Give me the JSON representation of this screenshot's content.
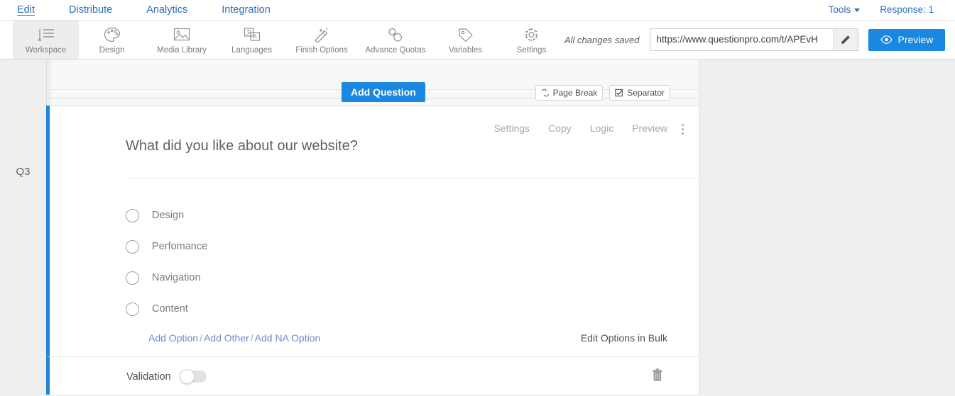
{
  "topnav": {
    "items": [
      {
        "label": "Edit",
        "active": true
      },
      {
        "label": "Distribute",
        "active": false
      },
      {
        "label": "Analytics",
        "active": false
      },
      {
        "label": "Integration",
        "active": false
      }
    ],
    "tools_label": "Tools",
    "response_label": "Response: 1"
  },
  "toolbar": {
    "items": [
      {
        "label": "Workspace",
        "icon": "workspace-icon",
        "active": true
      },
      {
        "label": "Design",
        "icon": "palette-icon",
        "active": false
      },
      {
        "label": "Media Library",
        "icon": "image-icon",
        "active": false
      },
      {
        "label": "Languages",
        "icon": "translate-icon",
        "active": false
      },
      {
        "label": "Finish Options",
        "icon": "magic-wand-icon",
        "active": false
      },
      {
        "label": "Advance Quotas",
        "icon": "link-chain-icon",
        "active": false
      },
      {
        "label": "Variables",
        "icon": "tag-icon",
        "active": false
      },
      {
        "label": "Settings",
        "icon": "gear-icon",
        "active": false
      }
    ],
    "saved_status": "All changes saved",
    "survey_url": "https://www.questionpro.com/t/APEvH",
    "edit_icon": "pencil-icon",
    "preview_label": "Preview",
    "preview_icon": "eye-icon"
  },
  "addbar": {
    "add_question_label": "Add Question",
    "page_break_label": "Page Break",
    "page_break_icon": "page-break-icon",
    "separator_label": "Separator",
    "separator_icon": "checked-box-icon"
  },
  "question": {
    "number": "Q3",
    "title": "What did you like about our website?",
    "actions": [
      "Settings",
      "Copy",
      "Logic",
      "Preview"
    ],
    "kebab_icon": "more-vertical-icon",
    "options": [
      {
        "label": "Design",
        "selected": false
      },
      {
        "label": "Perfomance",
        "selected": false
      },
      {
        "label": "Navigation",
        "selected": false
      },
      {
        "label": "Content",
        "selected": false
      }
    ],
    "add_links": [
      "Add Option",
      "Add Other",
      "Add NA Option"
    ],
    "link_separator": "/",
    "bulk_edit_label": "Edit Options in Bulk",
    "validation_label": "Validation",
    "validation_on": false,
    "delete_icon": "trash-icon"
  },
  "colors": {
    "accent": "#1a87e0",
    "link": "#2f6fb5",
    "page_bg": "#efefef",
    "card_bg": "#ffffff"
  }
}
